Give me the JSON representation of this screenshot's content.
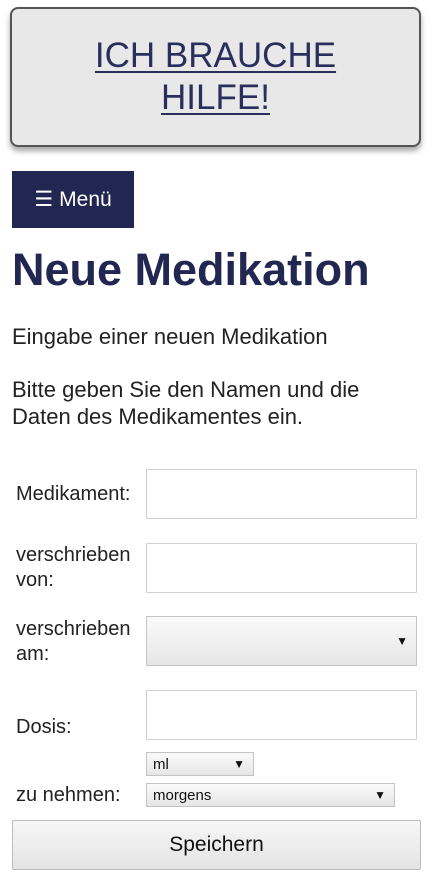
{
  "help": {
    "label": "ICH BRAUCHE HILFE!"
  },
  "menu": {
    "icon": "hamburger-icon",
    "icon_glyph": "☰",
    "label": "Menü"
  },
  "page": {
    "title": "Neue Medikation",
    "intro": "Eingabe einer neuen Medikation",
    "instructions": "Bitte geben Sie den Namen und die Daten des Medikamentes ein."
  },
  "form": {
    "medikament": {
      "label": "Medikament:",
      "value": ""
    },
    "verschrieben_von": {
      "label": "verschrieben von:",
      "value": ""
    },
    "verschrieben_am": {
      "label": "verschrieben am:",
      "selected": ""
    },
    "dosis": {
      "label": "Dosis:",
      "value": "",
      "unit_selected": "ml"
    },
    "zu_nehmen": {
      "label": "zu nehmen:",
      "selected": "morgens"
    },
    "dropdown_arrow": "▼",
    "save_label": "Speichern"
  },
  "colors": {
    "brand_navy": "#222751",
    "help_box_bg": "#e8e8e8",
    "help_text": "#2a2e5c"
  }
}
